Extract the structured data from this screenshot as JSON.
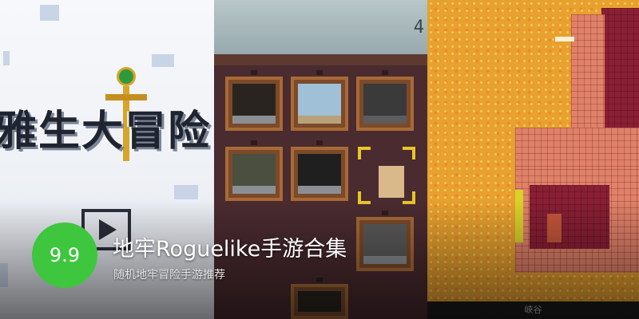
{
  "banner": {
    "score": "9.9",
    "title": "地牢Roguelike手游合集",
    "subtitle": "随机地牢冒险手游推荐"
  },
  "screenshots": {
    "left": {
      "game_title": "雅生大冒险"
    },
    "middle": {
      "top_number": "4"
    },
    "right": {
      "caption": "峡谷"
    }
  },
  "colors": {
    "score_badge": "#3fc63f",
    "title_text": "#ffffff",
    "lava": "#e8a12e",
    "dungeon_bg": "#4a2b30"
  }
}
